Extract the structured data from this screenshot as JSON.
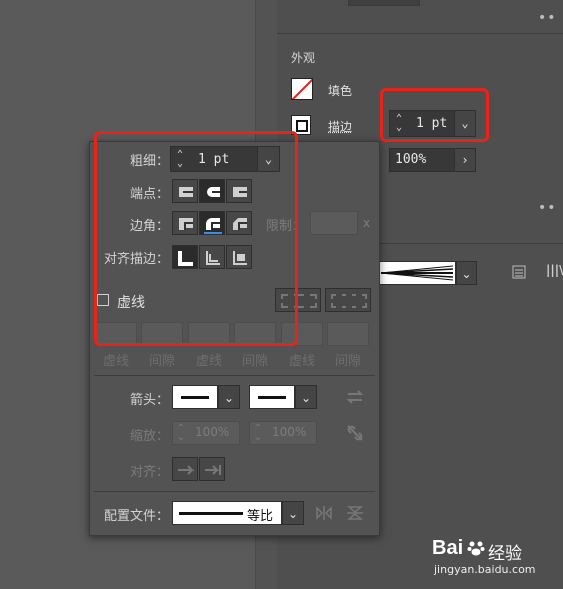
{
  "right_panel": {
    "more_menu_top": "••",
    "section_title": "外观",
    "fill_label": "填色",
    "stroke_label": "描边",
    "stroke_weight": "1 pt",
    "opacity": "100%",
    "more_menu_mid": "••",
    "brush_options_glyph": "|||\\"
  },
  "stroke_popup": {
    "weight_label": "粗细：",
    "weight_value": "1 pt",
    "cap_label": "端点：",
    "corner_label": "边角：",
    "limit_label": "限制：",
    "limit_suffix": "x",
    "align_label": "对齐描边：",
    "dashed_label": "虚线",
    "dash_headers": [
      "虚线",
      "间隙",
      "虚线",
      "间隙",
      "虚线",
      "间隙"
    ],
    "arrow_label": "箭头：",
    "scale_label": "缩放：",
    "scale_start": "100%",
    "scale_end": "100%",
    "arrow_align_label": "对齐：",
    "profile_label": "配置文件：",
    "profile_value": "等比"
  },
  "watermark": {
    "brand": "Bai",
    "brand_suffix": "经验",
    "url": "jingyan.baidu.com"
  },
  "colors": {
    "highlight": "#e8231a",
    "panel_bg": "#535353"
  }
}
